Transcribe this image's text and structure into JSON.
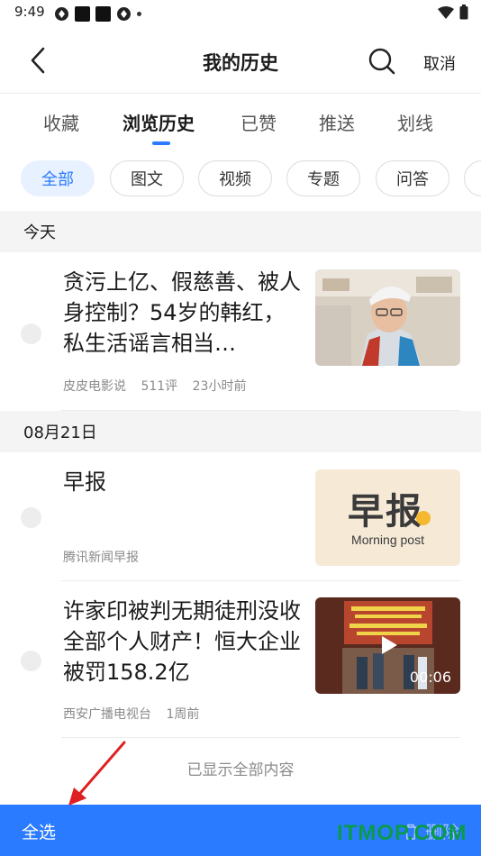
{
  "status_bar": {
    "time": "9:49"
  },
  "header": {
    "title": "我的历史",
    "cancel_label": "取消"
  },
  "tabs": [
    {
      "label": "收藏",
      "active": false
    },
    {
      "label": "浏览历史",
      "active": true
    },
    {
      "label": "已赞",
      "active": false
    },
    {
      "label": "推送",
      "active": false
    },
    {
      "label": "划线",
      "active": false
    }
  ],
  "filters": [
    {
      "label": "全部",
      "active": true
    },
    {
      "label": "图文",
      "active": false
    },
    {
      "label": "视频",
      "active": false
    },
    {
      "label": "专题",
      "active": false
    },
    {
      "label": "问答",
      "active": false
    }
  ],
  "sections": [
    {
      "date": "今天",
      "items": [
        {
          "title": "贪污上亿、假慈善、被人身控制？54岁的韩红，私生活谣言相当…",
          "source": "皮皮电影说",
          "comments": "511评",
          "time": "23小时前"
        }
      ]
    },
    {
      "date": "08月21日",
      "items": [
        {
          "title": "早报",
          "source": "腾讯新闻早报",
          "thumb_title": "早报",
          "thumb_subtitle": "Morning post"
        },
        {
          "title": "许家印被判无期徒刑没收全部个人财产！恒大企业被罚158.2亿",
          "source": "西安广播电视台",
          "time": "1周前",
          "video_duration": "00:06"
        }
      ]
    }
  ],
  "footer_note": "已显示全部内容",
  "bottom_bar": {
    "select_all_label": "全选",
    "delete_label": "删除"
  },
  "watermark": "ITMOP.COM",
  "colors": {
    "accent": "#2a7bff",
    "chip_active_bg": "#e8f1ff",
    "section_bg": "#f4f4f4"
  }
}
